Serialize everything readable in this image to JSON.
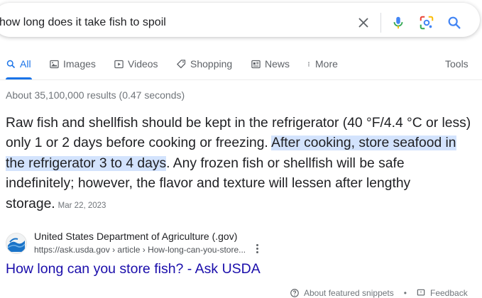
{
  "search": {
    "query": "how long does it take fish to spoil",
    "icons": [
      "close-icon",
      "microphone-icon",
      "lens-icon",
      "search-icon"
    ]
  },
  "tabs": [
    {
      "label": "All",
      "icon": "search-icon",
      "active": true
    },
    {
      "label": "Images",
      "icon": "image-icon"
    },
    {
      "label": "Videos",
      "icon": "play-icon"
    },
    {
      "label": "Shopping",
      "icon": "tag-icon"
    },
    {
      "label": "News",
      "icon": "news-icon"
    },
    {
      "label": "More",
      "icon": "more-vert-icon"
    }
  ],
  "tools_label": "Tools",
  "result_stats": "About 35,100,000 results (0.47 seconds)",
  "snippet": {
    "text_before": "Raw fish and shellfish should be kept in the refrigerator (40 °F/4.4 °C or less) only 1 or 2 days before cooking or freezing. ",
    "highlight": "After cooking, store seafood in the refrigerator 3 to 4 days",
    "text_after": ". Any frozen fish or shellfish will be safe indefinitely; however, the flavor and texture will lessen after lengthy storage.",
    "date": "Mar 22, 2023"
  },
  "source": {
    "site_name": "United States Department of Agriculture (.gov)",
    "url": "https://ask.usda.gov › article › How-long-can-you-store..."
  },
  "result_title": "How long can you store fish? - Ask USDA",
  "footer": {
    "about": "About featured snippets",
    "feedback": "Feedback"
  },
  "colors": {
    "accent": "#1a73e8",
    "link": "#1a0dab",
    "highlight": "#d3e3fd"
  }
}
